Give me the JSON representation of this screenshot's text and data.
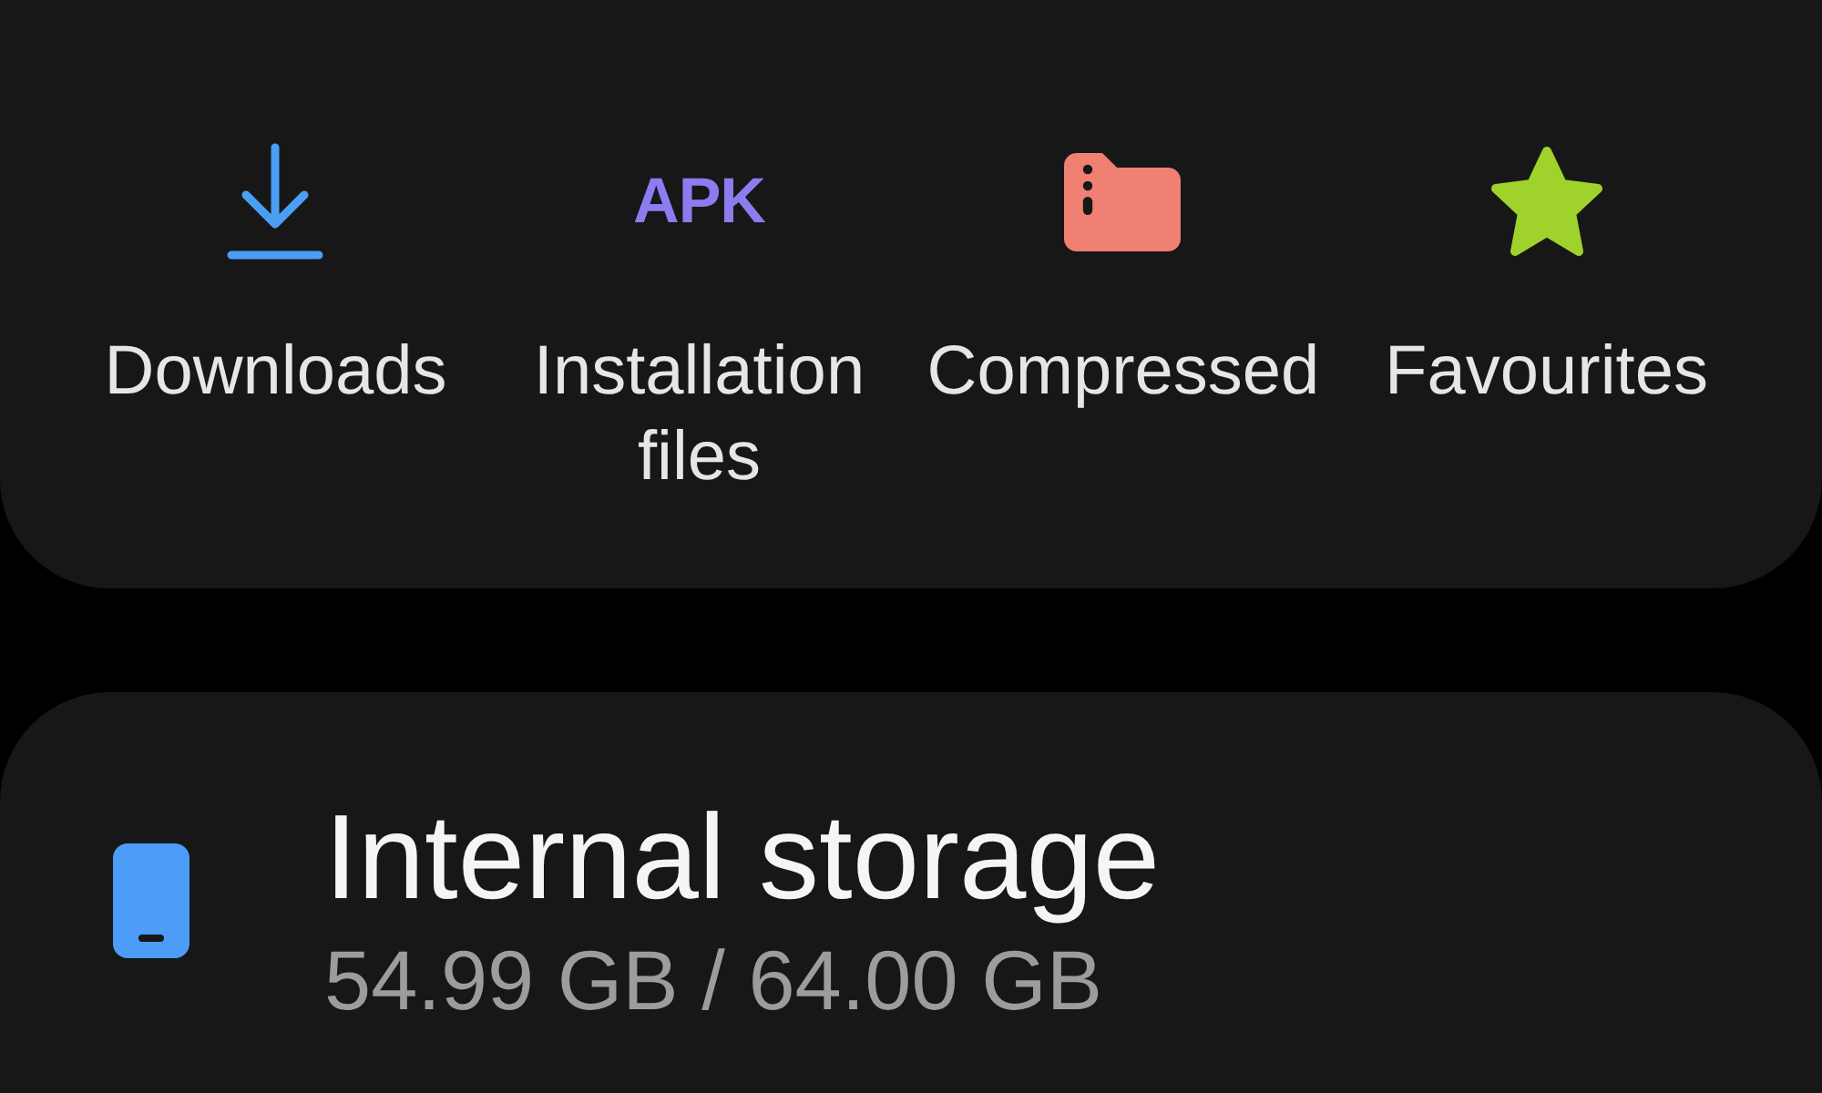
{
  "categories": [
    {
      "kind": "download",
      "label": "Downloads",
      "color": "#4a9ff5"
    },
    {
      "kind": "apk",
      "icon_text": "APK",
      "label": "Installation files",
      "color": "#8b7cf0"
    },
    {
      "kind": "archive",
      "label": "Compressed",
      "color": "#f08073"
    },
    {
      "kind": "star",
      "label": "Favourites",
      "color": "#9fd22a"
    }
  ],
  "storage": {
    "title": "Internal storage",
    "usage": "54.99 GB / 64.00 GB",
    "color": "#4d9cf8"
  }
}
